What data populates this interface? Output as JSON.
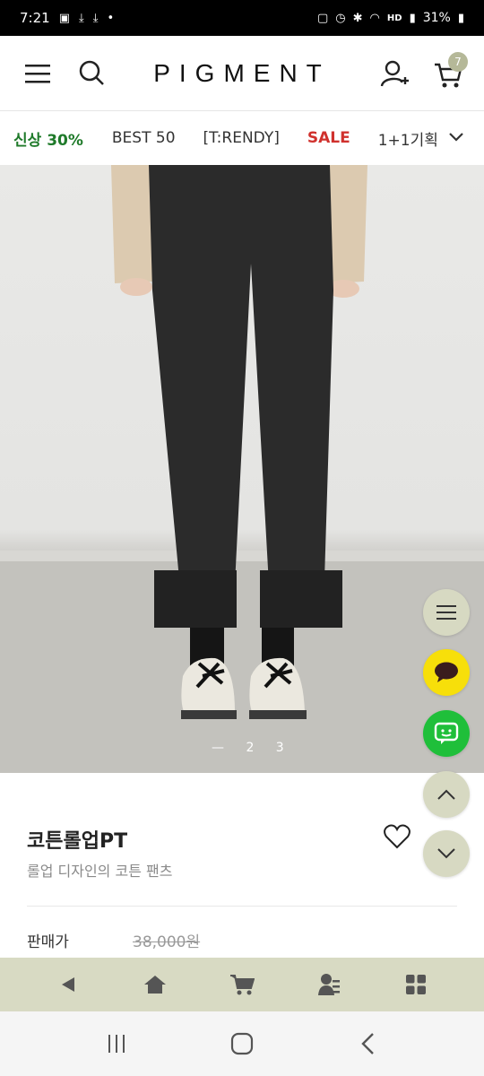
{
  "status_bar": {
    "time": "7:21",
    "network_label": "HD",
    "battery": "31%"
  },
  "header": {
    "logo": "PIGMENT",
    "cart_count": "7"
  },
  "nav": {
    "items": [
      "신상 30%",
      "BEST 50",
      "[T:RENDY]",
      "SALE",
      "1+1기획"
    ]
  },
  "hero": {
    "slide_indicator": "— 2 3"
  },
  "product": {
    "name": "코튼롤업PT",
    "description": "롤업 디자인의 코튼 팬츠",
    "price_label": "판매가",
    "original_price": "38,000원"
  },
  "icons": {
    "menu": "hamburger-icon",
    "search": "search-icon",
    "user": "user-add-icon",
    "cart": "cart-icon",
    "heart": "heart-icon",
    "share": "share-icon",
    "chevron": "chevron-down-icon"
  },
  "colors": {
    "accent_green": "#1f7a2a",
    "sale_red": "#d0312d",
    "toolbar_bg": "#d8dac3",
    "kakao_yellow": "#f7df0a",
    "talk_green": "#1fbf3a"
  }
}
